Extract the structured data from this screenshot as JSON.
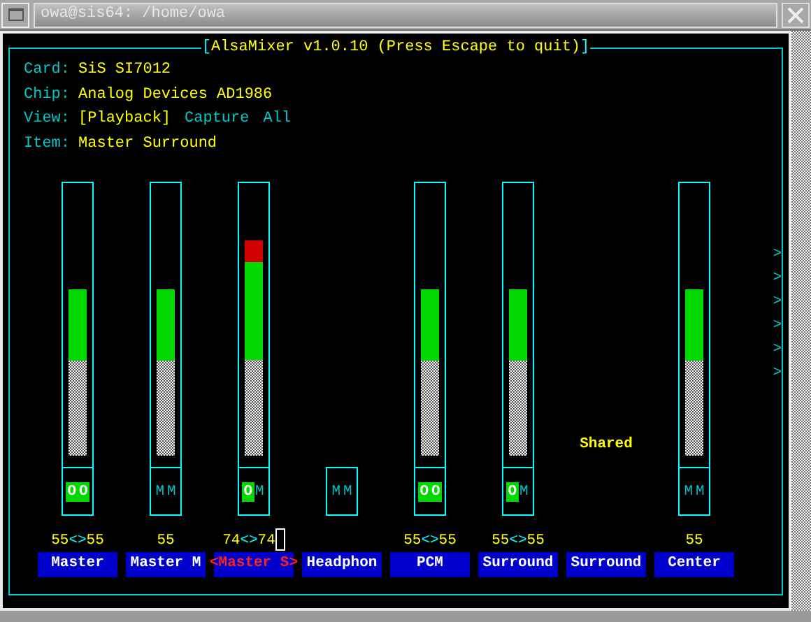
{
  "window": {
    "title": "owa@sis64: /home/owa"
  },
  "mixer": {
    "title_open": "[",
    "title": "AlsaMixer v1.0.10 (Press Escape to quit)",
    "title_close": "]",
    "info": [
      {
        "label": "Card:",
        "value": "SiS SI7012"
      },
      {
        "label": "Chip:",
        "value": "Analog Devices AD1986"
      }
    ],
    "view_label": "View:",
    "views": [
      {
        "label": "[Playback]",
        "selected": true
      },
      {
        "label": "Capture",
        "selected": false
      },
      {
        "label": "All",
        "selected": false
      }
    ],
    "item_label": "Item:",
    "item_value": "Master Surround",
    "channels": [
      {
        "kind": "full",
        "name": "Master",
        "selected": false,
        "level": 0.62,
        "volume": [
          "55",
          "55"
        ],
        "separator": "<>",
        "switches": [
          {
            "text": "O",
            "on": true
          },
          {
            "text": "O",
            "on": true
          }
        ]
      },
      {
        "kind": "full",
        "name": "Master M",
        "selected": false,
        "level": 0.62,
        "volume": [
          "55"
        ],
        "switches": [
          {
            "text": "M",
            "on": false
          },
          {
            "text": "M",
            "on": false
          }
        ]
      },
      {
        "kind": "full",
        "name": "Master S",
        "selected": true,
        "open": "<",
        "close": ">",
        "level": 0.8,
        "volume": [
          "74",
          "74"
        ],
        "separator": "<>",
        "switches": [
          {
            "text": "O",
            "on": true
          },
          {
            "text": "M",
            "on": false
          }
        ]
      },
      {
        "kind": "switch",
        "name": "Headphon",
        "selected": false,
        "switches": [
          {
            "text": "M",
            "on": false
          },
          {
            "text": "M",
            "on": false
          }
        ]
      },
      {
        "kind": "full",
        "name": "PCM",
        "selected": false,
        "level": 0.62,
        "volume": [
          "55",
          "55"
        ],
        "separator": "<>",
        "switches": [
          {
            "text": "O",
            "on": true
          },
          {
            "text": "O",
            "on": true
          }
        ]
      },
      {
        "kind": "full",
        "name": "Surround",
        "selected": false,
        "level": 0.62,
        "volume": [
          "55",
          "55"
        ],
        "separator": "<>",
        "switches": [
          {
            "text": "O",
            "on": true
          },
          {
            "text": "M",
            "on": false
          }
        ]
      },
      {
        "kind": "shared",
        "name": "Surround",
        "selected": false,
        "note": "Shared"
      },
      {
        "kind": "full",
        "name": "Center",
        "selected": false,
        "level": 0.62,
        "volume": [
          "55"
        ],
        "switches": [
          {
            "text": "M",
            "on": false
          },
          {
            "text": "M",
            "on": false
          }
        ]
      }
    ],
    "more_marks": [
      ">",
      ">",
      ">",
      ">",
      ">",
      ">"
    ]
  }
}
